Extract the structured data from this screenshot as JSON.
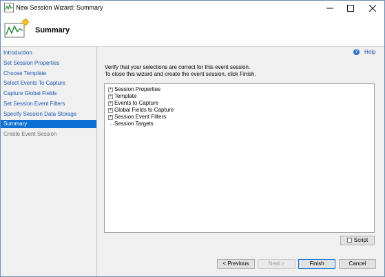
{
  "window": {
    "title": "New Session Wizard: Summary"
  },
  "header": {
    "title": "Summary"
  },
  "nav": {
    "items": [
      {
        "label": "Introduction",
        "state": "link"
      },
      {
        "label": "Set Session Properties",
        "state": "link"
      },
      {
        "label": "Choose Template",
        "state": "link"
      },
      {
        "label": "Select Events To Capture",
        "state": "link"
      },
      {
        "label": "Capture Global Fields",
        "state": "link"
      },
      {
        "label": "Set Session Event Filters",
        "state": "link"
      },
      {
        "label": "Specify Session Data Storage",
        "state": "link"
      },
      {
        "label": "Summary",
        "state": "selected"
      },
      {
        "label": "Create Event Session",
        "state": "disabled"
      }
    ]
  },
  "content": {
    "help_label": "Help",
    "instruction_line1": "Verify that your selections are correct for this event session.",
    "instruction_line2": "To close this wizard and create the event session, click Finish.",
    "tree": [
      {
        "label": "Session Properties",
        "expandable": true
      },
      {
        "label": "Template",
        "expandable": true
      },
      {
        "label": "Events to Capture",
        "expandable": true
      },
      {
        "label": "Global Fields to Capture",
        "expandable": true
      },
      {
        "label": "Session Event Filters",
        "expandable": true
      },
      {
        "label": "Session Targets",
        "expandable": false
      }
    ],
    "script_label": "Script"
  },
  "footer": {
    "previous_label": "< Previous",
    "next_label": "Next >",
    "finish_label": "Finish",
    "cancel_label": "Cancel"
  },
  "colors": {
    "selection": "#0c6fd6",
    "link": "#1a56b3",
    "window_border": "#6b8fb5"
  }
}
